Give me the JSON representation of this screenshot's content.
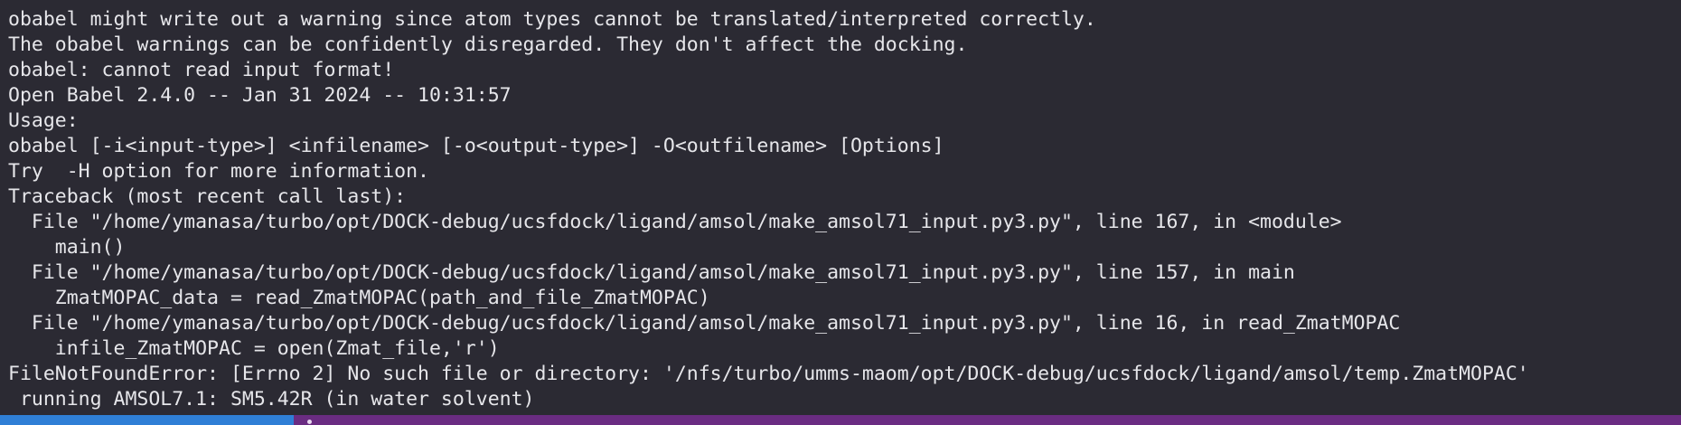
{
  "terminal": {
    "lines": [
      "obabel might write out a warning since atom types cannot be translated/interpreted correctly.",
      "The obabel warnings can be confidently disregarded. They don't affect the docking.",
      "obabel: cannot read input format!",
      "Open Babel 2.4.0 -- Jan 31 2024 -- 10:31:57",
      "Usage:",
      "obabel [-i<input-type>] <infilename> [-o<output-type>] -O<outfilename> [Options]",
      "Try  -H option for more information.",
      "Traceback (most recent call last):",
      "  File \"/home/ymanasa/turbo/opt/DOCK-debug/ucsfdock/ligand/amsol/make_amsol71_input.py3.py\", line 167, in <module>",
      "    main()",
      "  File \"/home/ymanasa/turbo/opt/DOCK-debug/ucsfdock/ligand/amsol/make_amsol71_input.py3.py\", line 157, in main",
      "    ZmatMOPAC_data = read_ZmatMOPAC(path_and_file_ZmatMOPAC)",
      "  File \"/home/ymanasa/turbo/opt/DOCK-debug/ucsfdock/ligand/amsol/make_amsol71_input.py3.py\", line 16, in read_ZmatMOPAC",
      "    infile_ZmatMOPAC = open(Zmat_file,'r')",
      "FileNotFoundError: [Errno 2] No such file or directory: '/nfs/turbo/umms-maom/opt/DOCK-debug/ucsfdock/ligand/amsol/temp.ZmatMOPAC'",
      " running AMSOL7.1: SM5.42R (in water solvent)"
    ]
  },
  "colors": {
    "background": "#2b2a33",
    "text": "#e6e6ea",
    "statusbar": "#6a2c82",
    "statusbar_left": "#2f7fd6"
  }
}
